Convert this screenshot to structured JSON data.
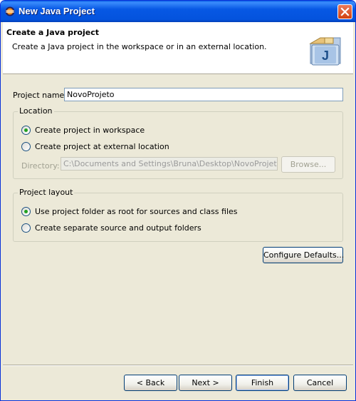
{
  "window": {
    "title": "New Java Project",
    "icon": "eclipse-icon"
  },
  "banner": {
    "title": "Create a Java project",
    "description": "Create a Java project in the workspace or in an external location.",
    "icon": "java-project-icon"
  },
  "project_name": {
    "label": "Project name:",
    "value": "NovoProjeto"
  },
  "location": {
    "group_label": "Location",
    "options": [
      {
        "label": "Create project in workspace",
        "selected": true
      },
      {
        "label": "Create project at external location",
        "selected": false
      }
    ],
    "directory_label": "Directory:",
    "directory_value": "C:\\Documents and Settings\\Bruna\\Desktop\\NovoProjeto",
    "browse_label": "Browse..."
  },
  "project_layout": {
    "group_label": "Project layout",
    "options": [
      {
        "label": "Use project folder as root for sources and class files",
        "selected": true
      },
      {
        "label": "Create separate source and output folders",
        "selected": false
      }
    ],
    "configure_label": "Configure Defaults..."
  },
  "footer": {
    "back_label": "< Back",
    "next_label": "Next >",
    "finish_label": "Finish",
    "cancel_label": "Cancel"
  }
}
